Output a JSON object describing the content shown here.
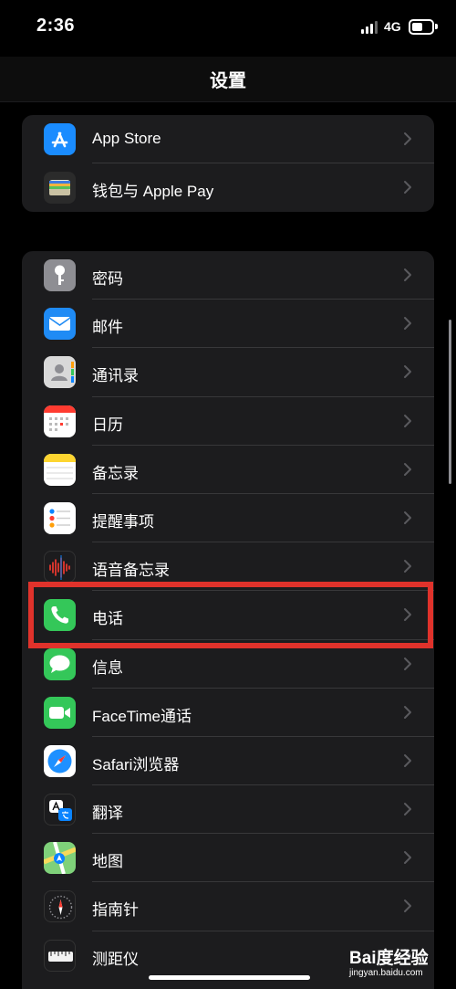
{
  "status_bar": {
    "time": "2:36",
    "network": "4G"
  },
  "nav": {
    "title": "设置"
  },
  "groups": [
    {
      "items": [
        {
          "label": "App Store",
          "icon": "app-store-icon",
          "color": "#1a8cff"
        },
        {
          "label": "钱包与 Apple Pay",
          "icon": "wallet-icon",
          "color": "#2b2b2b"
        }
      ]
    },
    {
      "items": [
        {
          "label": "密码",
          "icon": "key-icon",
          "color": "#8e8e93"
        },
        {
          "label": "邮件",
          "icon": "mail-icon",
          "color": "#1f8bf5"
        },
        {
          "label": "通讯录",
          "icon": "contacts-icon",
          "color": "#d9d9d9"
        },
        {
          "label": "日历",
          "icon": "calendar-icon",
          "color": "#ffffff"
        },
        {
          "label": "备忘录",
          "icon": "notes-icon",
          "color": "#fdd530"
        },
        {
          "label": "提醒事项",
          "icon": "reminders-icon",
          "color": "#ffffff"
        },
        {
          "label": "语音备忘录",
          "icon": "voice-memos-icon",
          "color": "#1c1c1e"
        },
        {
          "label": "电话",
          "icon": "phone-icon",
          "color": "#34c759"
        },
        {
          "label": "信息",
          "icon": "messages-icon",
          "color": "#34c759"
        },
        {
          "label": "FaceTime通话",
          "icon": "facetime-icon",
          "color": "#34c759"
        },
        {
          "label": "Safari浏览器",
          "icon": "safari-icon",
          "color": "#ffffff"
        },
        {
          "label": "翻译",
          "icon": "translate-icon",
          "color": "#1c1c1e"
        },
        {
          "label": "地图",
          "icon": "maps-icon",
          "color": "#7fd17a"
        },
        {
          "label": "指南针",
          "icon": "compass-icon",
          "color": "#1c1c1e"
        },
        {
          "label": "测距仪",
          "icon": "measure-icon",
          "color": "#1c1c1e"
        }
      ]
    }
  ],
  "highlight": {
    "target": "电话",
    "color": "#e0322b"
  },
  "watermark": {
    "brand": "Bai度经验",
    "url": "jingyan.baidu.com"
  }
}
